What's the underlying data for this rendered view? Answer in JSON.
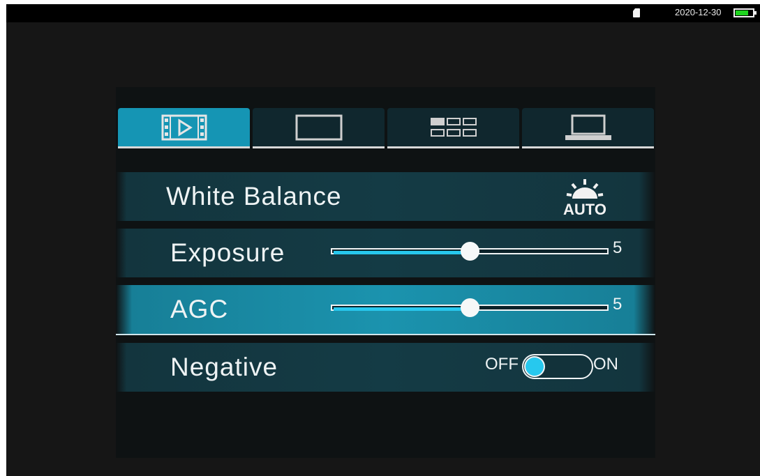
{
  "status_bar": {
    "date": "2020-12-30",
    "sd_icon": "sd-card-icon",
    "battery_icon": "battery-icon",
    "battery_level": 0.7
  },
  "tabs": [
    {
      "icon": "video-play-icon",
      "active": true
    },
    {
      "icon": "single-screen-icon",
      "active": false
    },
    {
      "icon": "grid-icon",
      "active": false
    },
    {
      "icon": "laptop-icon",
      "active": false
    }
  ],
  "settings": {
    "white_balance": {
      "label": "White Balance",
      "icon": "sun-auto-icon",
      "icon_text": "AUTO"
    },
    "exposure": {
      "label": "Exposure",
      "value": "5",
      "level": 0.5
    },
    "agc": {
      "label": "AGC",
      "value": "5",
      "level": 0.5
    },
    "negative": {
      "label": "Negative",
      "off_label": "OFF",
      "on_label": "ON",
      "state": "off"
    }
  },
  "colors": {
    "accent": "#1595b4",
    "slider_fill": "#27c8ee",
    "battery": "#1fd41f"
  }
}
